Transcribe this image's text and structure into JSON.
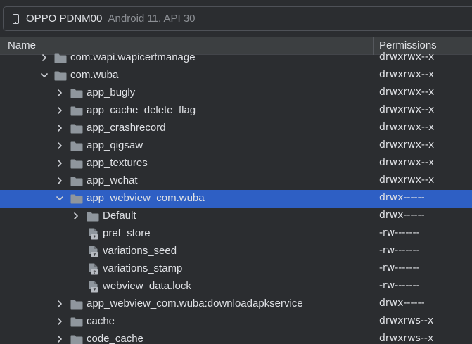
{
  "device": {
    "name": "OPPO PDNM00",
    "info": "Android 11, API 30",
    "icon": "phone-icon"
  },
  "columns": {
    "name": "Name",
    "permissions": "Permissions"
  },
  "rows": [
    {
      "label": "com.wapi.wapicertmanage",
      "perm": "drwxrwx--x",
      "depth": 0,
      "type": "folder",
      "chevron": "right",
      "selected": false
    },
    {
      "label": "com.wuba",
      "perm": "drwxrwx--x",
      "depth": 0,
      "type": "folder",
      "chevron": "down",
      "selected": false
    },
    {
      "label": "app_bugly",
      "perm": "drwxrwx--x",
      "depth": 1,
      "type": "folder",
      "chevron": "right",
      "selected": false
    },
    {
      "label": "app_cache_delete_flag",
      "perm": "drwxrwx--x",
      "depth": 1,
      "type": "folder",
      "chevron": "right",
      "selected": false
    },
    {
      "label": "app_crashrecord",
      "perm": "drwxrwx--x",
      "depth": 1,
      "type": "folder",
      "chevron": "right",
      "selected": false
    },
    {
      "label": "app_qigsaw",
      "perm": "drwxrwx--x",
      "depth": 1,
      "type": "folder",
      "chevron": "right",
      "selected": false
    },
    {
      "label": "app_textures",
      "perm": "drwxrwx--x",
      "depth": 1,
      "type": "folder",
      "chevron": "right",
      "selected": false
    },
    {
      "label": "app_wchat",
      "perm": "drwxrwx--x",
      "depth": 1,
      "type": "folder",
      "chevron": "right",
      "selected": false
    },
    {
      "label": "app_webview_com.wuba",
      "perm": "drwx------",
      "depth": 1,
      "type": "folder",
      "chevron": "down",
      "selected": true
    },
    {
      "label": "Default",
      "perm": "drwx------",
      "depth": 2,
      "type": "folder",
      "chevron": "right",
      "selected": false
    },
    {
      "label": "pref_store",
      "perm": "-rw-------",
      "depth": 2,
      "type": "file",
      "chevron": "none",
      "selected": false
    },
    {
      "label": "variations_seed",
      "perm": "-rw-------",
      "depth": 2,
      "type": "file",
      "chevron": "none",
      "selected": false
    },
    {
      "label": "variations_stamp",
      "perm": "-rw-------",
      "depth": 2,
      "type": "file",
      "chevron": "none",
      "selected": false
    },
    {
      "label": "webview_data.lock",
      "perm": "-rw-------",
      "depth": 2,
      "type": "file",
      "chevron": "none",
      "selected": false
    },
    {
      "label": "app_webview_com.wuba:downloadapkservice",
      "perm": "drwx------",
      "depth": 1,
      "type": "folder",
      "chevron": "right",
      "selected": false
    },
    {
      "label": "cache",
      "perm": "drwxrws--x",
      "depth": 1,
      "type": "folder",
      "chevron": "right",
      "selected": false
    },
    {
      "label": "code_cache",
      "perm": "drwxrws--x",
      "depth": 1,
      "type": "folder",
      "chevron": "right",
      "selected": false
    }
  ],
  "colors": {
    "background": "#2b2d30",
    "selection": "#2e5fc4",
    "folder": "#8f969d",
    "text": "#dfe1e5",
    "muted": "#8c8f94"
  }
}
